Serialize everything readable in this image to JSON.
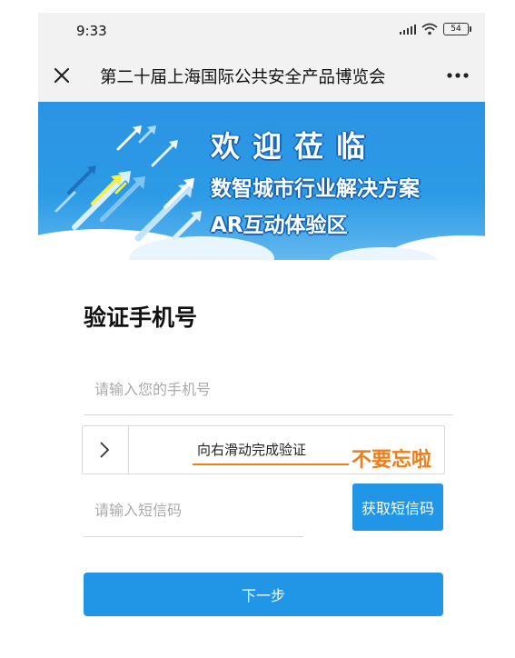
{
  "status_bar": {
    "time": "9:33",
    "battery": "54"
  },
  "nav": {
    "title": "第二十届上海国际公共安全产品博览会",
    "close_icon": "close-icon",
    "more_icon": "more-icon"
  },
  "banner": {
    "line1": "欢迎莅临",
    "line2": "数智城市行业解决方案",
    "line3": "AR互动体验区"
  },
  "form": {
    "title": "验证手机号",
    "phone_placeholder": "请输入您的手机号",
    "slider_text": "向右滑动完成验证",
    "annotation": "不要忘啦",
    "sms_placeholder": "请输入短信码",
    "sms_button": "获取短信码",
    "next_button": "下一步"
  },
  "colors": {
    "primary": "#2196e6",
    "annotation": "#ef7d1a",
    "banner": "#2b93e3"
  }
}
